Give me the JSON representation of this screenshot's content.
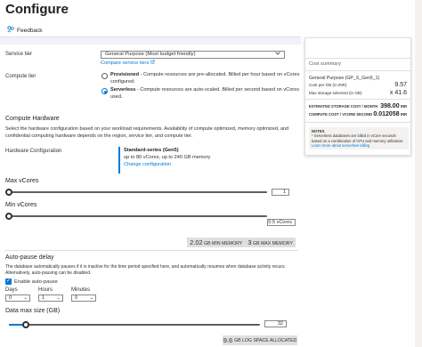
{
  "header": {
    "title": "Configure",
    "ellipsis": "···"
  },
  "toolbar": {
    "feedback_label": "Feedback"
  },
  "service_tier": {
    "label": "Service tier",
    "selected": "General Purpose (Most budget friendly)",
    "compare_link": "Compare service tiers"
  },
  "compute_tier": {
    "label": "Compute tier",
    "provisioned_name": "Provisioned",
    "provisioned_desc": " - Compute resources are pre-allocated. Billed per hour based on vCores configured.",
    "serverless_name": "Serverless",
    "serverless_desc": " - Compute resources are auto-scaled. Billed per second based on vCores used.",
    "selected": "Serverless"
  },
  "compute_hardware": {
    "heading": "Compute Hardware",
    "desc": "Select the hardware configuration based on your workload requirements. Availability of compute optimized, memory optimized, and confidential computing hardware depends on the region, service tier, and compute tier.",
    "config_label": "Hardware Configuration",
    "config_name": "Standard-series (Gen5)",
    "config_detail": "up to 80 vCores, up to 240 GB memory",
    "change_link": "Change configuration"
  },
  "max_vcores": {
    "label": "Max vCores",
    "value": "1"
  },
  "min_vcores": {
    "label": "Min vCores",
    "value": "0.5 vCores"
  },
  "memory": {
    "min_value": "2.02",
    "min_unit": "GB MIN MEMORY",
    "max_value": "3",
    "max_unit": "GB MAX MEMORY"
  },
  "auto_pause": {
    "heading": "Auto-pause delay",
    "desc": "The database automatically pauses if it is inactive for the time period specified here, and automatically resumes when database activity recurs. Alternatively, auto-pausing can be disabled.",
    "enable_label": "Enable auto-pause",
    "days_label": "Days",
    "days_value": "0",
    "hours_label": "Hours",
    "hours_value": "1",
    "minutes_label": "Minutes",
    "minutes_value": "0"
  },
  "data_max_size": {
    "label": "Data max size (GB)",
    "value": "32"
  },
  "log_space": {
    "value": "9.6",
    "unit": "GB LOG SPACE ALLOCATED"
  },
  "cost_summary": {
    "heading": "Cost summary",
    "tier_line": "General Purpose (GP_S_Gen5_1)",
    "cost_per_gb_label": "Cost per GB (in INR)",
    "cost_per_gb_value": "9.57",
    "max_storage_label": "Max storage selected (in GB)",
    "max_storage_value": "x 41.6",
    "est_storage_label": "ESTIMATED STORAGE COST / MONTH",
    "est_storage_value": "398.00",
    "est_storage_unit": "INR",
    "compute_label": "COMPUTE COST / VCORE SECOND",
    "compute_value": "0.012058",
    "compute_unit": "INR",
    "notes_heading": "NOTES",
    "notes_text": "* Serverless databases are billed in vCore seconds based on a combination of CPU and memory utilization.",
    "notes_link": "Learn more about serverless billing"
  },
  "colors": {
    "accent": "#0078d4",
    "band": "#e1dfdd",
    "lilac": "#f3f0fa"
  }
}
